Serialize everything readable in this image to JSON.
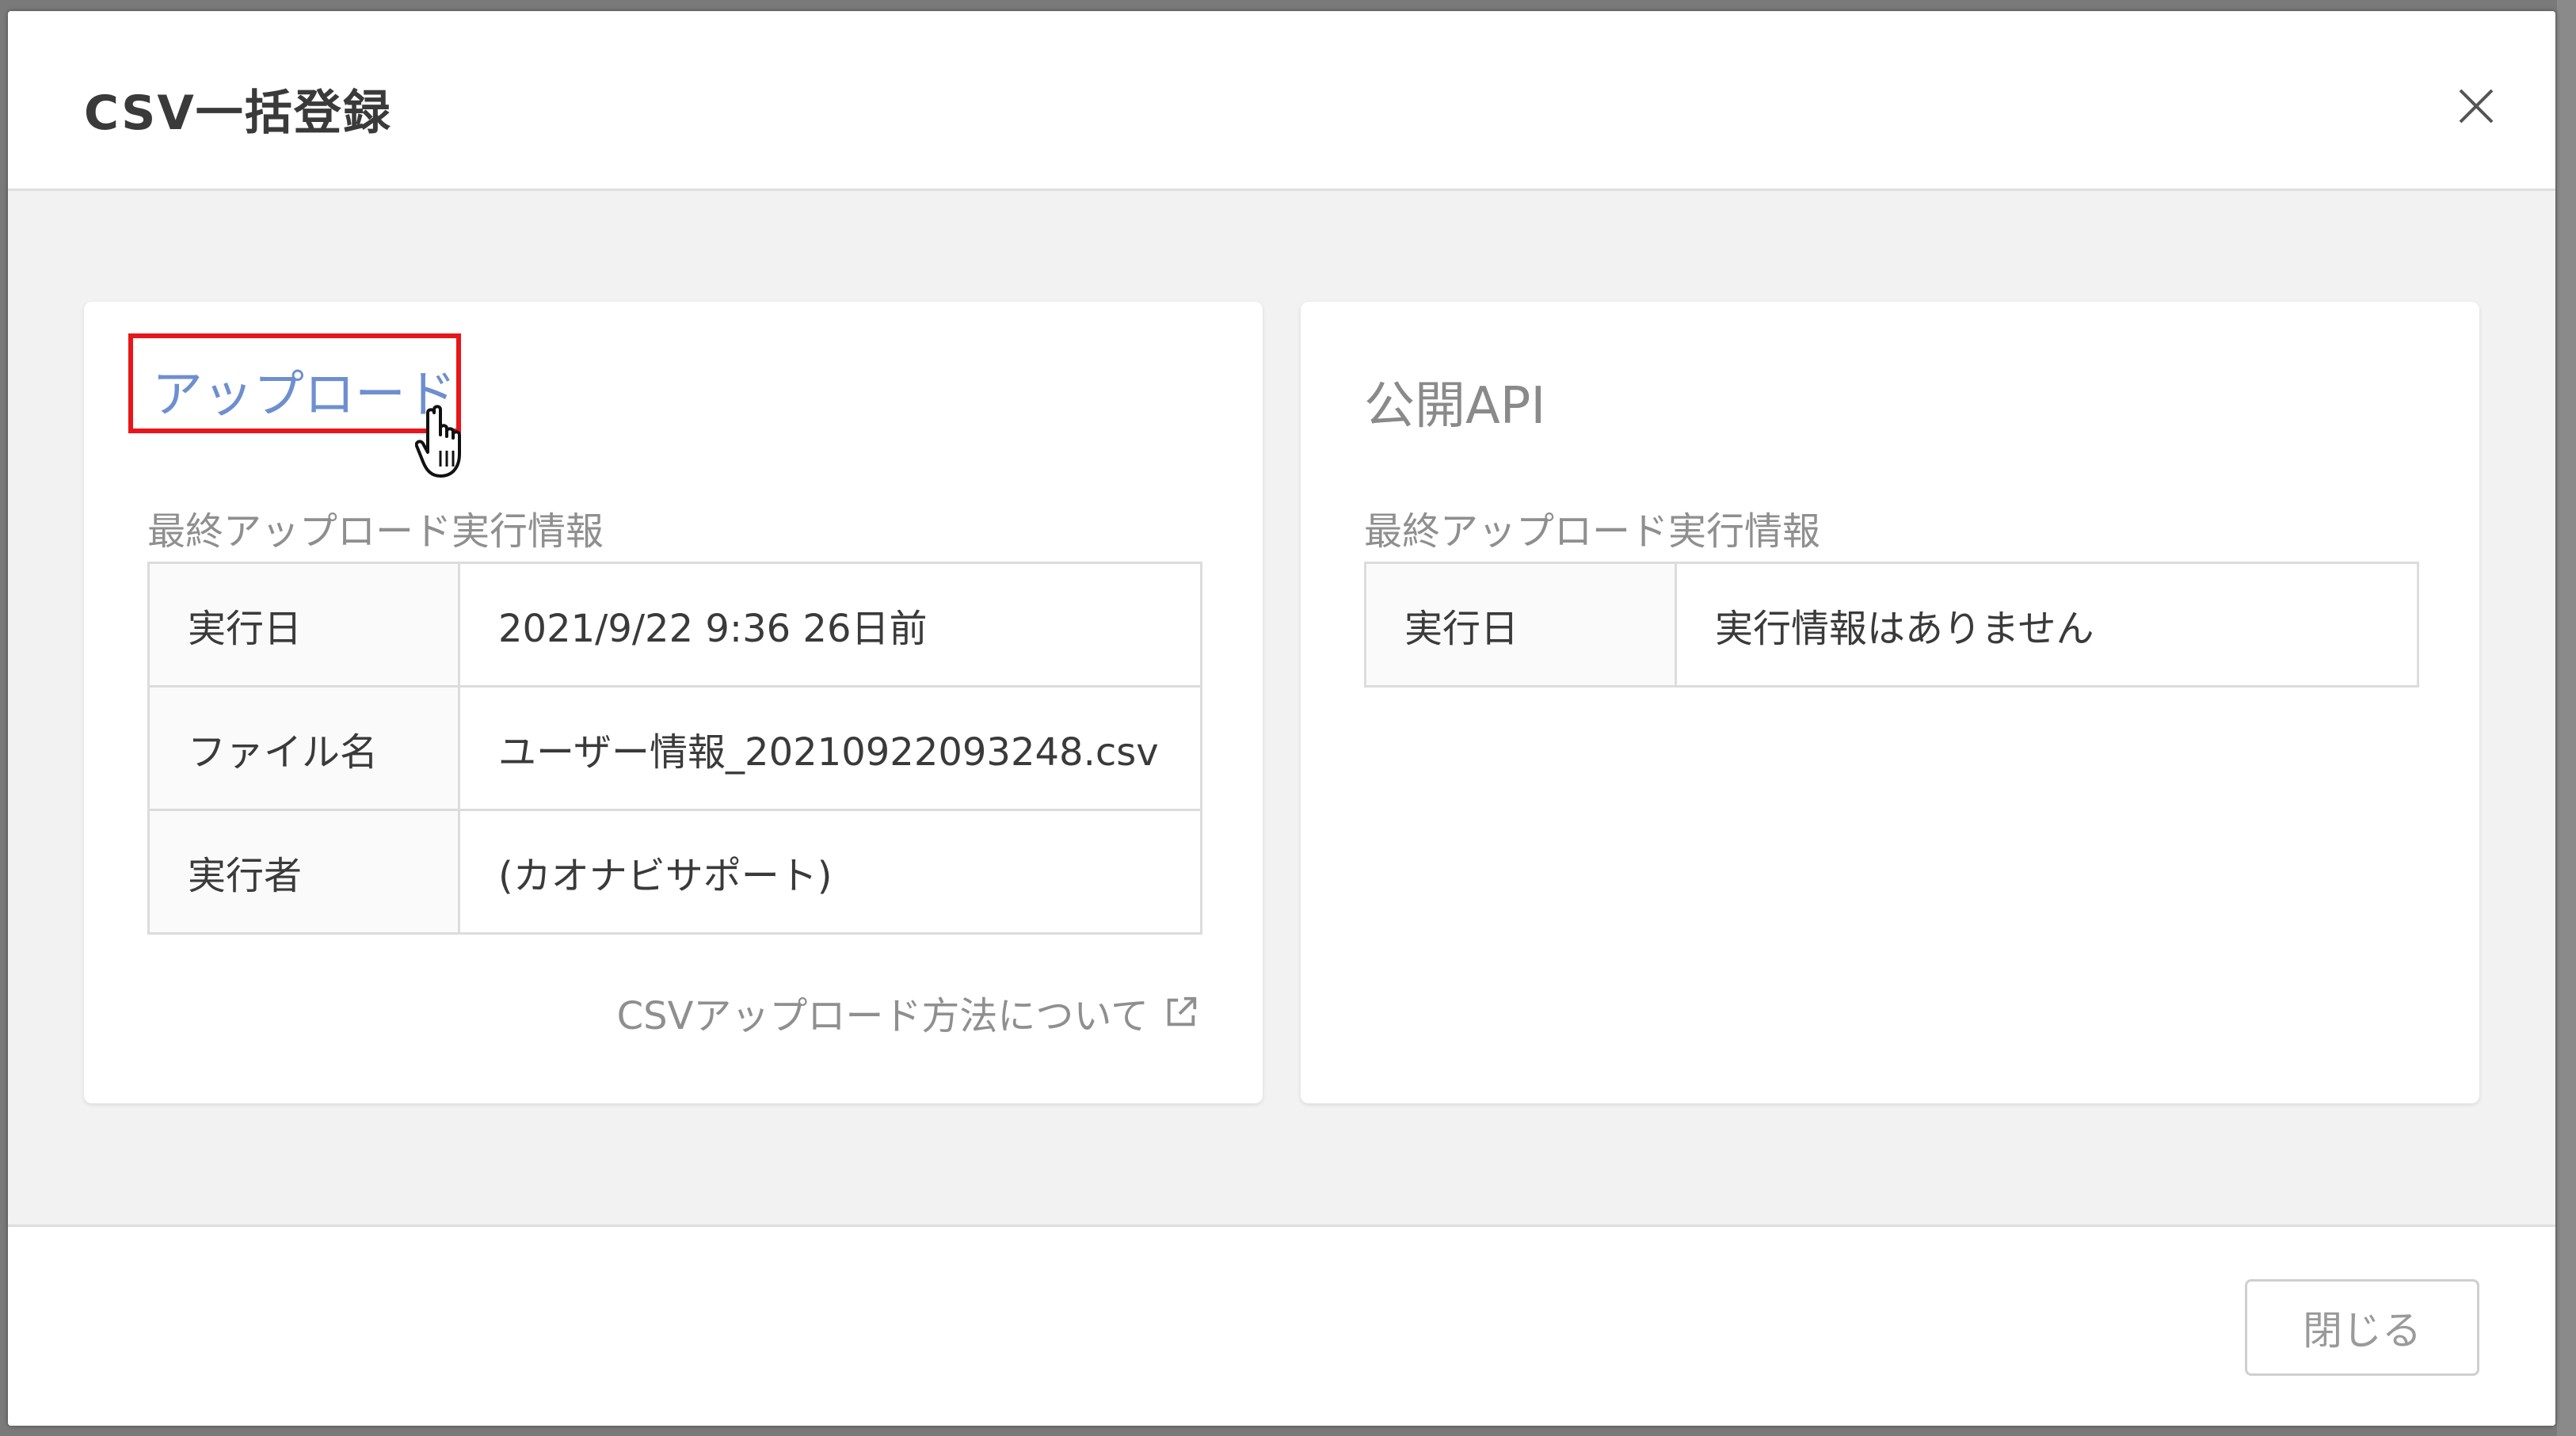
{
  "modal": {
    "title": "CSV一括登録",
    "close_icon": "close-icon"
  },
  "upload_card": {
    "link_label": "アップロード",
    "section_label": "最終アップロード実行情報",
    "rows": [
      {
        "label": "実行日",
        "value": "2021/9/22 9:36 26日前"
      },
      {
        "label": "ファイル名",
        "value": "ユーザー情報_20210922093248.csv"
      },
      {
        "label": "実行者",
        "value": "(カオナビサポート)"
      }
    ],
    "help_link": "CSVアップロード方法について",
    "help_icon": "external-link-icon"
  },
  "api_card": {
    "title": "公開API",
    "section_label": "最終アップロード実行情報",
    "rows": [
      {
        "label": "実行日",
        "value": "実行情報はありません"
      }
    ]
  },
  "footer": {
    "close_button": "閉じる"
  },
  "colors": {
    "link": "#6e8fcf",
    "highlight_box": "#e8161b"
  }
}
